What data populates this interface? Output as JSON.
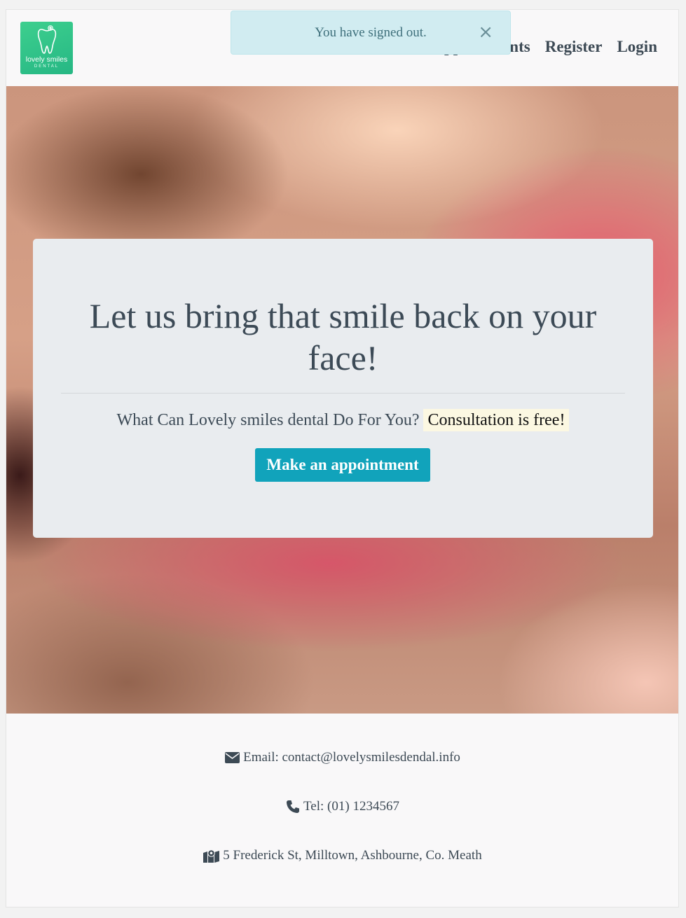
{
  "brand": {
    "name": "lovely smiles",
    "sub": "DENTAL",
    "accent": "#2fc489"
  },
  "nav": {
    "links": [
      "Appointments",
      "Register",
      "Login"
    ]
  },
  "alert": {
    "message": "You have signed out.",
    "close": "×"
  },
  "hero": {
    "title": "Let us bring that smile back on your face!",
    "lead": "What Can Lovely smiles dental Do For You?",
    "highlight": "Consultation is free!",
    "cta": "Make an appointment",
    "cta_color": "#17a2b8"
  },
  "contact": {
    "email": "Email: contact@lovelysmilesdendal.info",
    "tel": "Tel: (01) 1234567",
    "address": "5 Frederick St, Milltown, Ashbourne, Co. Meath"
  },
  "icons": {
    "email": "envelope-icon",
    "tel": "phone-icon",
    "address": "map-marker-icon",
    "logo": "tooth-icon"
  }
}
